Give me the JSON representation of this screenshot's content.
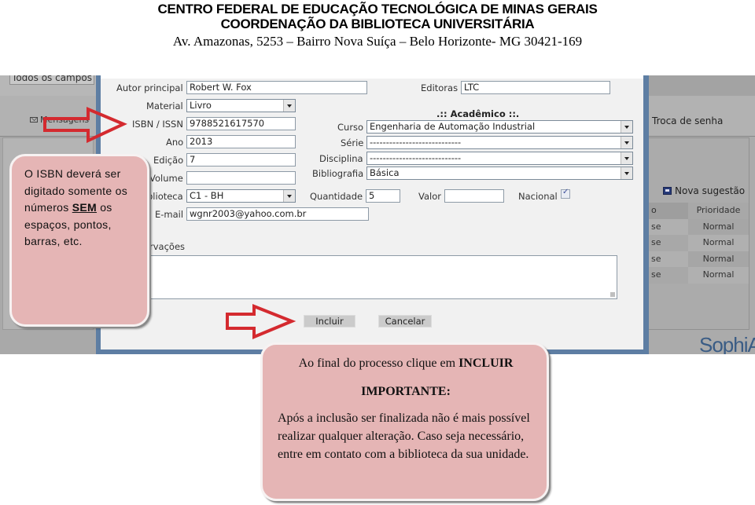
{
  "header": {
    "line1": "CENTRO FEDERAL DE EDUCAÇÃO TECNOLÓGICA DE MINAS GERAIS",
    "line2": "COORDENAÇÃO DA BIBLIOTECA UNIVERSITÁRIA",
    "line3": "Av. Amazonas, 5253 – Bairro Nova Suíça – Belo Horizonte- MG 30421-169"
  },
  "left_sidebar": {
    "todos_label": "Todos os campos",
    "mensagens_label": "Mensagens",
    "mensagens_icon": "envelope-icon"
  },
  "right_sidebar": {
    "troca_label": "Troca de senha",
    "nova_sugestao_label": "Nova sugestão",
    "nova_sugestao_icon": "chat-bubble-icon",
    "grid": {
      "headers": [
        "o",
        "Prioridade"
      ],
      "rows": [
        [
          "se",
          "Normal"
        ],
        [
          "se",
          "Normal"
        ],
        [
          "se",
          "Normal"
        ],
        [
          "se",
          "Normal"
        ]
      ]
    },
    "logo": "SophiA"
  },
  "form": {
    "autor_principal": {
      "label": "Autor principal",
      "value": "Robert W. Fox"
    },
    "editoras": {
      "label": "Editoras",
      "value": "LTC"
    },
    "material": {
      "label": "Material",
      "value": "Livro"
    },
    "isbn": {
      "label": "ISBN / ISSN",
      "value": "9788521617570"
    },
    "ano": {
      "label": "Ano",
      "value": "2013"
    },
    "edicao": {
      "label": "Edição",
      "value": "7"
    },
    "volume": {
      "label": "Volume",
      "value": ""
    },
    "biblioteca": {
      "label": "blioteca",
      "value": "C1 - BH"
    },
    "email": {
      "label": "E-mail",
      "value": "wgnr2003@yahoo.com.br"
    },
    "observacoes": {
      "label": "rvações",
      "value": ""
    },
    "academico_title": ".:: Acadêmico ::.",
    "curso": {
      "label": "Curso",
      "value": "Engenharia de Automação Industrial"
    },
    "serie": {
      "label": "Série",
      "value": "----------------------------"
    },
    "disciplina": {
      "label": "Disciplina",
      "value": "----------------------------"
    },
    "bibliografia": {
      "label": "Bibliografia",
      "value": "Básica"
    },
    "quantidade": {
      "label": "Quantidade",
      "value": "5"
    },
    "valor": {
      "label": "Valor",
      "value": ""
    },
    "nacional": {
      "label": "Nacional",
      "checked": true
    },
    "incluir_label": "Incluir",
    "cancelar_label": "Cancelar"
  },
  "callouts": {
    "isbn": {
      "part1": "O ISBN deverá ser digitado somente os números ",
      "emphasis": "SEM",
      "part2": " os espaços, pontos, barras, etc."
    },
    "final": {
      "line1_prefix": "Ao final do processo clique em ",
      "line1_bold": "INCLUIR",
      "important": "IMPORTANTE:",
      "body": "Após a inclusão ser finalizada não é mais possível realizar qualquer alteração. Caso seja necessário, entre em contato com a biblioteca da sua unidade."
    }
  },
  "colors": {
    "callout_fill": "#e5b5b5",
    "arrow_red": "#d42a2f",
    "frame_blue": "#5e7ea3"
  }
}
